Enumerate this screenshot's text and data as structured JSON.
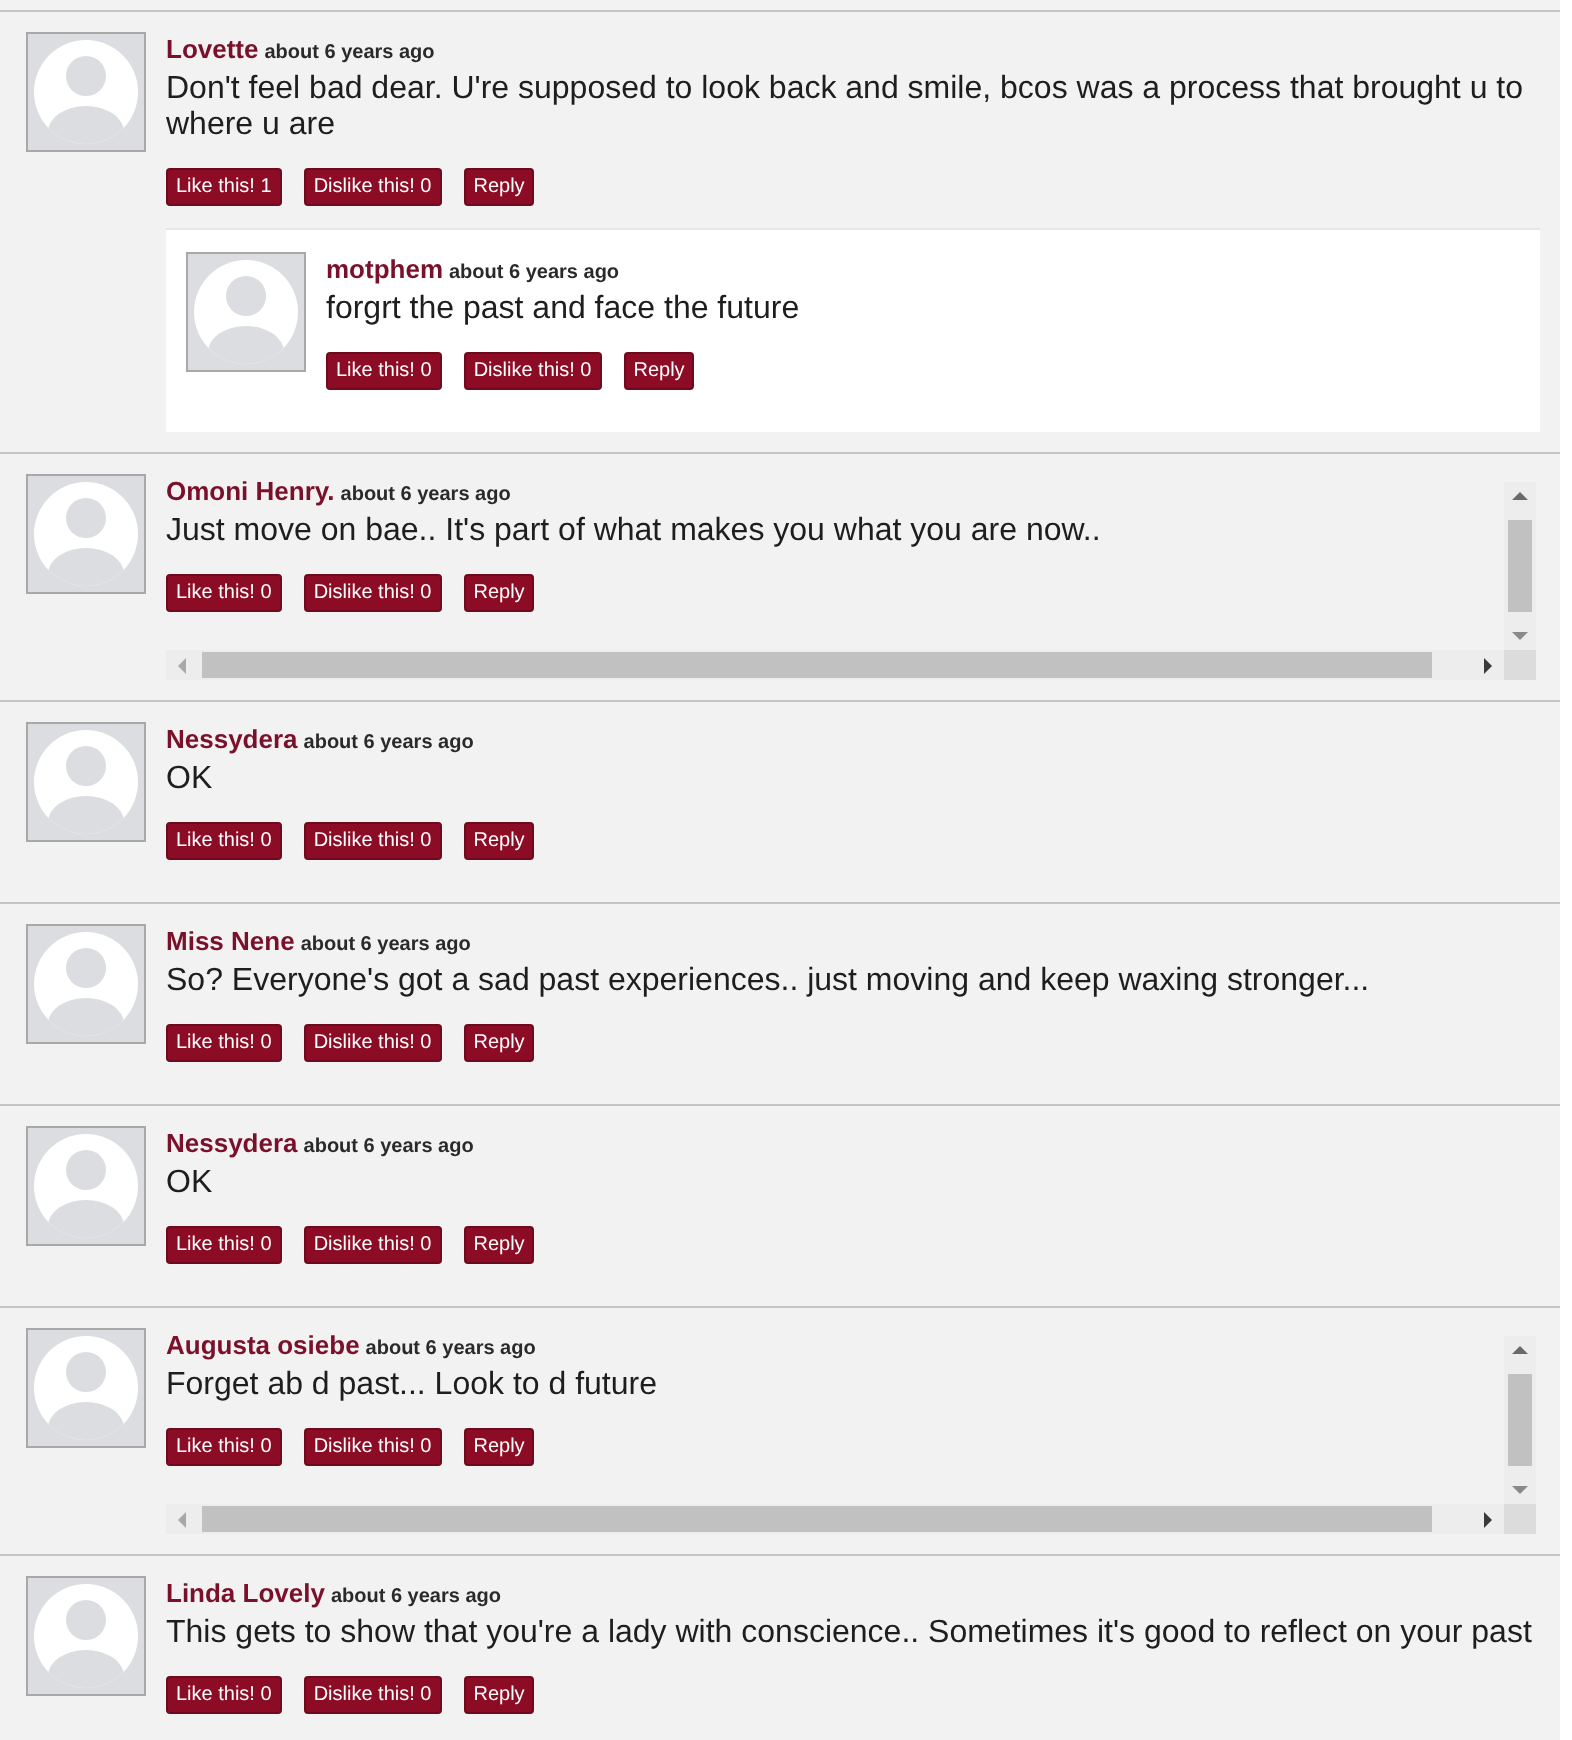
{
  "comments": [
    {
      "author": "Lovette",
      "time": "about 6 years ago",
      "text": "Don't feel bad dear. U're supposed to look back and smile, bcos was a process that brought u to where u are",
      "buttons": [
        "Like this! 1",
        "Dislike this! 0",
        "Reply"
      ],
      "scrollable": false,
      "replies": [
        {
          "author": "motphem",
          "time": "about 6 years ago",
          "text": "forgrt the past and face the future",
          "buttons": [
            "Like this! 0",
            "Dislike this! 0",
            "Reply"
          ],
          "scrollable": false
        }
      ]
    },
    {
      "author": "Omoni Henry.",
      "time": "about 6 years ago",
      "text": "Just move on bae.. It's part of what makes you what you are now..",
      "buttons": [
        "Like this! 0",
        "Dislike this! 0",
        "Reply"
      ],
      "scrollable": true
    },
    {
      "author": "Nessydera",
      "time": "about 6 years ago",
      "text": "OK",
      "buttons": [
        "Like this! 0",
        "Dislike this! 0",
        "Reply"
      ],
      "scrollable": false
    },
    {
      "author": "Miss Nene",
      "time": "about 6 years ago",
      "text": "So? Everyone's got a sad past experiences.. just moving and keep waxing stronger...",
      "buttons": [
        "Like this! 0",
        "Dislike this! 0",
        "Reply"
      ],
      "scrollable": false
    },
    {
      "author": "Nessydera",
      "time": "about 6 years ago",
      "text": "OK",
      "buttons": [
        "Like this! 0",
        "Dislike this! 0",
        "Reply"
      ],
      "scrollable": false
    },
    {
      "author": "Augusta osiebe",
      "time": "about 6 years ago",
      "text": "Forget ab d past... Look to d future",
      "buttons": [
        "Like this! 0",
        "Dislike this! 0",
        "Reply"
      ],
      "scrollable": true
    },
    {
      "author": "Linda Lovely",
      "time": "about 6 years ago",
      "text": "This gets to show that you're a lady with conscience.. Sometimes it's good to reflect on your past",
      "buttons": [
        "Like this! 0",
        "Dislike this! 0",
        "Reply"
      ],
      "scrollable": false
    }
  ]
}
